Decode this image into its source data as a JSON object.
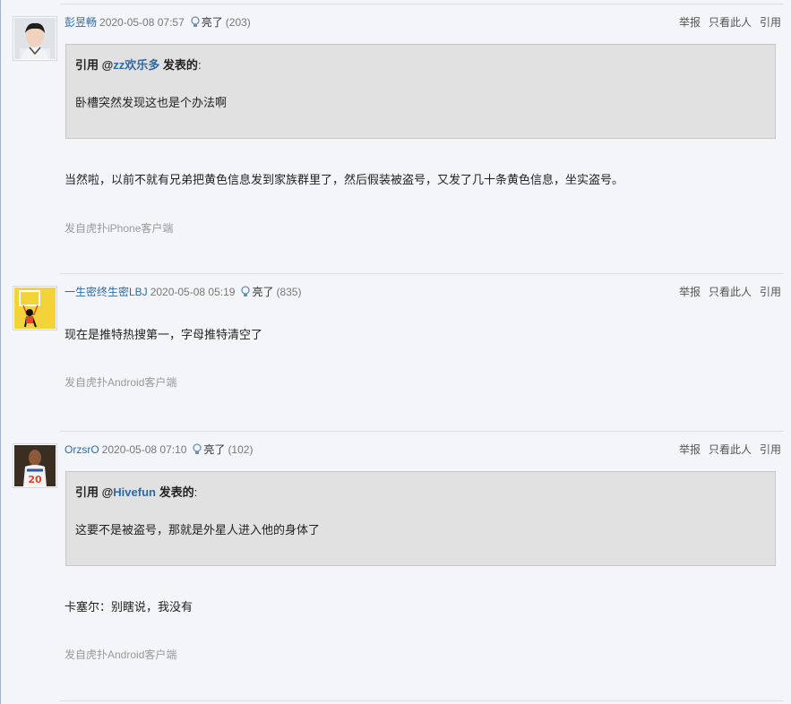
{
  "posts": [
    {
      "user": "彭昱畅",
      "time": "2020-05-08 07:57",
      "liang_label": "亮了",
      "liang_count": "(203)",
      "actions": {
        "report": "举报",
        "only_this": "只看此人",
        "quote": "引用"
      },
      "quote": {
        "prefix": "引用 @",
        "user": "zz欢乐多",
        "suffix": " 发表的",
        "colon": ":",
        "text": "卧槽突然发现这也是个办法啊"
      },
      "content": "当然啦，以前不就有兄弟把黄色信息发到家族群里了，然后假装被盗号，又发了几十条黄色信息，坐实盗号。",
      "source": "发自虎扑iPhone客户端"
    },
    {
      "user": "一生密终生密LBJ",
      "time": "2020-05-08 05:19",
      "liang_label": "亮了",
      "liang_count": "(835)",
      "actions": {
        "report": "举报",
        "only_this": "只看此人",
        "quote": "引用"
      },
      "content": "现在是推特热搜第一，字母推特清空了",
      "source": "发自虎扑Android客户端"
    },
    {
      "user": "OrzsrO",
      "time": "2020-05-08 07:10",
      "liang_label": "亮了",
      "liang_count": "(102)",
      "actions": {
        "report": "举报",
        "only_this": "只看此人",
        "quote": "引用"
      },
      "quote": {
        "prefix": "引用 @",
        "user": "Hivefun",
        "suffix": " 发表的",
        "colon": ":",
        "text": "这要不是被盗号，那就是外星人进入他的身体了"
      },
      "content": "卡塞尔：别瞎说，我没有",
      "source": "发自虎扑Android客户端"
    }
  ]
}
